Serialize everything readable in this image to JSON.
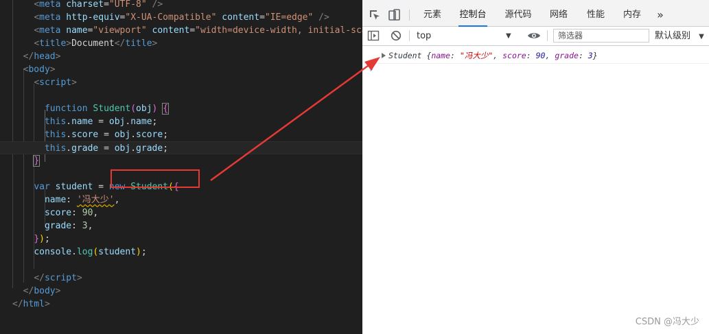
{
  "editor": {
    "lines": [
      [
        {
          "t": "    ",
          "c": "txt"
        },
        {
          "t": "<",
          "c": "punc"
        },
        {
          "t": "meta",
          "c": "tag"
        },
        {
          "t": " charset",
          "c": "attr"
        },
        {
          "t": "=",
          "c": "txt"
        },
        {
          "t": "\"UTF-8\"",
          "c": "str"
        },
        {
          "t": " />",
          "c": "punc"
        }
      ],
      [
        {
          "t": "    ",
          "c": "txt"
        },
        {
          "t": "<",
          "c": "punc"
        },
        {
          "t": "meta",
          "c": "tag"
        },
        {
          "t": " http-equiv",
          "c": "attr"
        },
        {
          "t": "=",
          "c": "txt"
        },
        {
          "t": "\"X-UA-Compatible\"",
          "c": "str"
        },
        {
          "t": " content",
          "c": "attr"
        },
        {
          "t": "=",
          "c": "txt"
        },
        {
          "t": "\"IE=edge\"",
          "c": "str"
        },
        {
          "t": " />",
          "c": "punc"
        }
      ],
      [
        {
          "t": "    ",
          "c": "txt"
        },
        {
          "t": "<",
          "c": "punc"
        },
        {
          "t": "meta",
          "c": "tag"
        },
        {
          "t": " name",
          "c": "attr"
        },
        {
          "t": "=",
          "c": "txt"
        },
        {
          "t": "\"viewport\"",
          "c": "str"
        },
        {
          "t": " content",
          "c": "attr"
        },
        {
          "t": "=",
          "c": "txt"
        },
        {
          "t": "\"width=device-width, initial-scal",
          "c": "str"
        }
      ],
      [
        {
          "t": "    ",
          "c": "txt"
        },
        {
          "t": "<",
          "c": "punc"
        },
        {
          "t": "title",
          "c": "tag"
        },
        {
          "t": ">",
          "c": "punc"
        },
        {
          "t": "Document",
          "c": "txt"
        },
        {
          "t": "</",
          "c": "punc"
        },
        {
          "t": "title",
          "c": "tag"
        },
        {
          "t": ">",
          "c": "punc"
        }
      ],
      [
        {
          "t": "  ",
          "c": "txt"
        },
        {
          "t": "</",
          "c": "punc"
        },
        {
          "t": "head",
          "c": "tag"
        },
        {
          "t": ">",
          "c": "punc"
        }
      ],
      [
        {
          "t": "  ",
          "c": "txt"
        },
        {
          "t": "<",
          "c": "punc"
        },
        {
          "t": "body",
          "c": "tag"
        },
        {
          "t": ">",
          "c": "punc"
        }
      ],
      [
        {
          "t": "    ",
          "c": "txt"
        },
        {
          "t": "<",
          "c": "punc"
        },
        {
          "t": "script",
          "c": "tag"
        },
        {
          "t": ">",
          "c": "punc"
        }
      ],
      [],
      [
        {
          "t": "      ",
          "c": "txt"
        },
        {
          "t": "function",
          "c": "kw"
        },
        {
          "t": " ",
          "c": "txt"
        },
        {
          "t": "Student",
          "c": "fn"
        },
        {
          "t": "(",
          "c": "br2"
        },
        {
          "t": "obj",
          "c": "prop"
        },
        {
          "t": ")",
          "c": "br2"
        },
        {
          "t": " ",
          "c": "txt"
        },
        {
          "t": "{",
          "c": "br2",
          "box": true
        }
      ],
      [
        {
          "t": "      ",
          "c": "txt"
        },
        {
          "t": "this",
          "c": "kw"
        },
        {
          "t": ".",
          "c": "txt"
        },
        {
          "t": "name",
          "c": "prop"
        },
        {
          "t": " = ",
          "c": "txt"
        },
        {
          "t": "obj",
          "c": "prop"
        },
        {
          "t": ".",
          "c": "txt"
        },
        {
          "t": "name",
          "c": "prop"
        },
        {
          "t": ";",
          "c": "txt"
        }
      ],
      [
        {
          "t": "      ",
          "c": "txt"
        },
        {
          "t": "this",
          "c": "kw"
        },
        {
          "t": ".",
          "c": "txt"
        },
        {
          "t": "score",
          "c": "prop"
        },
        {
          "t": " = ",
          "c": "txt"
        },
        {
          "t": "obj",
          "c": "prop"
        },
        {
          "t": ".",
          "c": "txt"
        },
        {
          "t": "score",
          "c": "prop"
        },
        {
          "t": ";",
          "c": "txt"
        }
      ],
      [
        {
          "t": "      ",
          "c": "txt"
        },
        {
          "t": "this",
          "c": "kw"
        },
        {
          "t": ".",
          "c": "txt"
        },
        {
          "t": "grade",
          "c": "prop"
        },
        {
          "t": " = ",
          "c": "txt"
        },
        {
          "t": "obj",
          "c": "prop"
        },
        {
          "t": ".",
          "c": "txt"
        },
        {
          "t": "grade",
          "c": "prop"
        },
        {
          "t": ";",
          "c": "txt"
        }
      ],
      [
        {
          "t": "    ",
          "c": "txt"
        },
        {
          "t": "}",
          "c": "br2",
          "box": true
        }
      ],
      [],
      [
        {
          "t": "    ",
          "c": "txt"
        },
        {
          "t": "var",
          "c": "kw"
        },
        {
          "t": " ",
          "c": "txt"
        },
        {
          "t": "student",
          "c": "prop"
        },
        {
          "t": " = ",
          "c": "txt"
        },
        {
          "t": "new",
          "c": "kw"
        },
        {
          "t": " ",
          "c": "txt"
        },
        {
          "t": "Student",
          "c": "fn"
        },
        {
          "t": "(",
          "c": "br1"
        },
        {
          "t": "{",
          "c": "br2"
        }
      ],
      [
        {
          "t": "      ",
          "c": "txt"
        },
        {
          "t": "name",
          "c": "prop"
        },
        {
          "t": ": ",
          "c": "txt"
        },
        {
          "t": "'冯大少'",
          "c": "str",
          "squiggle": true
        },
        {
          "t": ",",
          "c": "txt"
        }
      ],
      [
        {
          "t": "      ",
          "c": "txt"
        },
        {
          "t": "score",
          "c": "prop"
        },
        {
          "t": ": ",
          "c": "txt"
        },
        {
          "t": "90",
          "c": "num"
        },
        {
          "t": ",",
          "c": "txt"
        }
      ],
      [
        {
          "t": "      ",
          "c": "txt"
        },
        {
          "t": "grade",
          "c": "prop"
        },
        {
          "t": ": ",
          "c": "txt"
        },
        {
          "t": "3",
          "c": "num"
        },
        {
          "t": ",",
          "c": "txt"
        }
      ],
      [
        {
          "t": "    ",
          "c": "txt"
        },
        {
          "t": "}",
          "c": "br2"
        },
        {
          "t": ")",
          "c": "br1"
        },
        {
          "t": ";",
          "c": "txt"
        }
      ],
      [
        {
          "t": "    ",
          "c": "txt"
        },
        {
          "t": "console",
          "c": "prop"
        },
        {
          "t": ".",
          "c": "txt"
        },
        {
          "t": "log",
          "c": "fn"
        },
        {
          "t": "(",
          "c": "br1"
        },
        {
          "t": "student",
          "c": "prop"
        },
        {
          "t": ")",
          "c": "br1"
        },
        {
          "t": ";",
          "c": "txt"
        }
      ],
      [],
      [
        {
          "t": "    ",
          "c": "txt"
        },
        {
          "t": "</",
          "c": "punc"
        },
        {
          "t": "script",
          "c": "tag"
        },
        {
          "t": ">",
          "c": "punc"
        }
      ],
      [
        {
          "t": "  ",
          "c": "txt"
        },
        {
          "t": "</",
          "c": "punc"
        },
        {
          "t": "body",
          "c": "tag"
        },
        {
          "t": ">",
          "c": "punc"
        }
      ],
      [
        {
          "t": "</",
          "c": "punc"
        },
        {
          "t": "html",
          "c": "tag"
        },
        {
          "t": ">",
          "c": "punc"
        }
      ]
    ]
  },
  "devtools": {
    "tabs": [
      {
        "label": "元素",
        "active": false
      },
      {
        "label": "控制台",
        "active": true
      },
      {
        "label": "源代码",
        "active": false
      },
      {
        "label": "网络",
        "active": false
      },
      {
        "label": "性能",
        "active": false
      },
      {
        "label": "内存",
        "active": false
      }
    ],
    "more_tabs": "»",
    "context": "top",
    "filter_placeholder": "筛选器",
    "level": "默认级别",
    "console": {
      "class_name": "Student",
      "name_key": "name",
      "name_value": "\"冯大少\"",
      "score_key": "score",
      "score_value": "90",
      "grade_key": "grade",
      "grade_value": "3",
      "prompt": "›"
    }
  },
  "watermark": "CSDN @冯大少",
  "colors": {
    "annotation_red": "#e53935",
    "accent_blue": "#1a73e8"
  }
}
